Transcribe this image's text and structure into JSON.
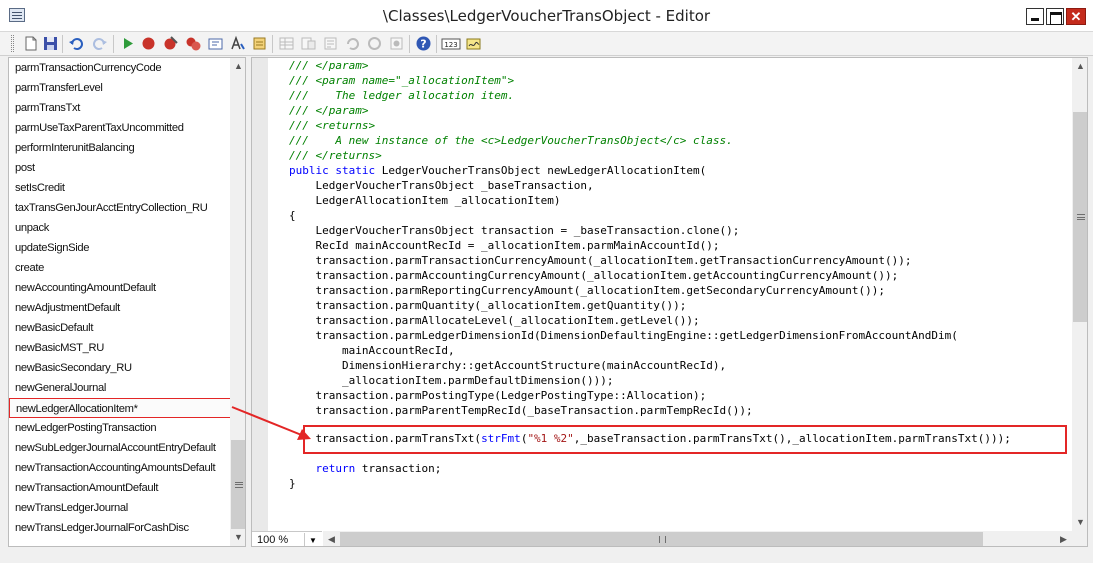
{
  "window": {
    "title": "\\Classes\\LedgerVoucherTransObject - Editor",
    "close_glyph": "✕"
  },
  "toolbar": {
    "icons": [
      "new-icon",
      "save-icon",
      "undo-icon",
      "redo-icon",
      "run-icon",
      "breakpoint-icon",
      "remove-breakpoints-icon",
      "toggle-breakpoints-icon",
      "compile-icon",
      "lookup-icon",
      "script-icon",
      "list-tables-icon",
      "list-classes-icon",
      "list-types-icon",
      "undo-list-icon",
      "refresh-icon",
      "labels-icon",
      "help-icon",
      "line-numbers-icon",
      "sign-icon"
    ],
    "help_glyph": "?",
    "linenum_label": "123"
  },
  "method_list": {
    "selected_index": 17,
    "items": [
      "parmTransactionCurrencyCode",
      "parmTransferLevel",
      "parmTransTxt",
      "parmUseTaxParentTaxUncommitted",
      "performInterunitBalancing",
      "post",
      "setIsCredit",
      "taxTransGenJourAcctEntryCollection_RU",
      "unpack",
      "updateSignSide",
      "create",
      "newAccountingAmountDefault",
      "newAdjustmentDefault",
      "newBasicDefault",
      "newBasicMST_RU",
      "newBasicSecondary_RU",
      "newGeneralJournal",
      "newLedgerAllocationItem*",
      "newLedgerPostingTransaction",
      "newSubLedgerJournalAccountEntryDefault",
      "newTransactionAccountingAmountsDefault",
      "newTransactionAmountDefault",
      "newTransLedgerJournal",
      "newTransLedgerJournalForCashDisc"
    ]
  },
  "editor": {
    "zoom": "100 %",
    "highlighted_line": 24,
    "lines": [
      {
        "indent": 0,
        "parts": [
          {
            "t": "c",
            "s": "/// </param>"
          }
        ]
      },
      {
        "indent": 0,
        "parts": [
          {
            "t": "c",
            "s": "/// <param name=\"_allocationItem\">"
          }
        ]
      },
      {
        "indent": 0,
        "parts": [
          {
            "t": "c",
            "s": "///    The ledger allocation item."
          }
        ]
      },
      {
        "indent": 0,
        "parts": [
          {
            "t": "c",
            "s": "/// </param>"
          }
        ]
      },
      {
        "indent": 0,
        "parts": [
          {
            "t": "c",
            "s": "/// <returns>"
          }
        ]
      },
      {
        "indent": 0,
        "parts": [
          {
            "t": "c",
            "s": "///    A new instance of the <c>LedgerVoucherTransObject</c> class."
          }
        ]
      },
      {
        "indent": 0,
        "parts": [
          {
            "t": "c",
            "s": "/// </returns>"
          }
        ]
      },
      {
        "indent": 0,
        "parts": [
          {
            "t": "k",
            "s": "public static "
          },
          {
            "t": "n",
            "s": "LedgerVoucherTransObject newLedgerAllocationItem("
          }
        ]
      },
      {
        "indent": 0,
        "parts": [
          {
            "t": "n",
            "s": "    LedgerVoucherTransObject _baseTransaction,"
          }
        ]
      },
      {
        "indent": 0,
        "parts": [
          {
            "t": "n",
            "s": "    LedgerAllocationItem _allocationItem)"
          }
        ]
      },
      {
        "indent": 0,
        "parts": [
          {
            "t": "n",
            "s": "{"
          }
        ]
      },
      {
        "indent": 0,
        "parts": [
          {
            "t": "n",
            "s": "    LedgerVoucherTransObject transaction = _baseTransaction.clone();"
          }
        ]
      },
      {
        "indent": 0,
        "parts": [
          {
            "t": "n",
            "s": "    RecId mainAccountRecId = _allocationItem.parmMainAccountId();"
          }
        ]
      },
      {
        "indent": 0,
        "parts": [
          {
            "t": "n",
            "s": "    transaction.parmTransactionCurrencyAmount(_allocationItem.getTransactionCurrencyAmount());"
          }
        ]
      },
      {
        "indent": 0,
        "parts": [
          {
            "t": "n",
            "s": "    transaction.parmAccountingCurrencyAmount(_allocationItem.getAccountingCurrencyAmount());"
          }
        ]
      },
      {
        "indent": 0,
        "parts": [
          {
            "t": "n",
            "s": "    transaction.parmReportingCurrencyAmount(_allocationItem.getSecondaryCurrencyAmount());"
          }
        ]
      },
      {
        "indent": 0,
        "parts": [
          {
            "t": "n",
            "s": "    transaction.parmQuantity(_allocationItem.getQuantity());"
          }
        ]
      },
      {
        "indent": 0,
        "parts": [
          {
            "t": "n",
            "s": "    transaction.parmAllocateLevel(_allocationItem.getLevel());"
          }
        ]
      },
      {
        "indent": 0,
        "parts": [
          {
            "t": "n",
            "s": "    transaction.parmLedgerDimensionId(DimensionDefaultingEngine::getLedgerDimensionFromAccountAndDim("
          }
        ]
      },
      {
        "indent": 0,
        "parts": [
          {
            "t": "n",
            "s": "        mainAccountRecId,"
          }
        ]
      },
      {
        "indent": 0,
        "parts": [
          {
            "t": "n",
            "s": "        DimensionHierarchy::getAccountStructure(mainAccountRecId),"
          }
        ]
      },
      {
        "indent": 0,
        "parts": [
          {
            "t": "n",
            "s": "        _allocationItem.parmDefaultDimension()));"
          }
        ]
      },
      {
        "indent": 0,
        "parts": [
          {
            "t": "n",
            "s": "    transaction.parmPostingType(LedgerPostingType::Allocation);"
          }
        ]
      },
      {
        "indent": 0,
        "parts": [
          {
            "t": "n",
            "s": "    transaction.parmParentTempRecId(_baseTransaction.parmTempRecId());"
          }
        ]
      },
      {
        "indent": 0,
        "parts": [
          {
            "t": "n",
            "s": "    transaction.parmTransTxt("
          },
          {
            "t": "k",
            "s": "strFmt"
          },
          {
            "t": "n",
            "s": "("
          },
          {
            "t": "s",
            "s": "\"%1 %2\""
          },
          {
            "t": "n",
            "s": ",_baseTransaction.parmTransTxt(),_allocationItem.parmTransTxt()));"
          }
        ]
      },
      {
        "indent": 0,
        "parts": [
          {
            "t": "n",
            "s": "    "
          },
          {
            "t": "k",
            "s": "return"
          },
          {
            "t": "n",
            "s": " transaction;"
          }
        ]
      },
      {
        "indent": 0,
        "parts": [
          {
            "t": "n",
            "s": "}"
          }
        ]
      }
    ]
  },
  "colors": {
    "annotation": "#e32626",
    "comment": "#008000",
    "keyword": "#0000ff",
    "string": "#a31515"
  }
}
